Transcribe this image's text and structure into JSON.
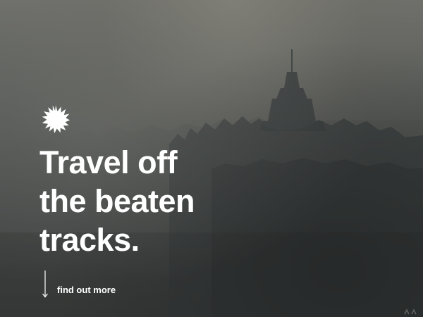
{
  "hero": {
    "headline_lines": [
      "Travel off",
      "the beaten",
      "tracks."
    ],
    "find_out_more_label": "find out more",
    "logo_icon": "sun-burst-icon",
    "scroll_icon": "arrow-down-icon",
    "text_color": "#ffffff",
    "background_tones": [
      "#6f706b",
      "#4b4d4c",
      "#2e3131"
    ]
  }
}
